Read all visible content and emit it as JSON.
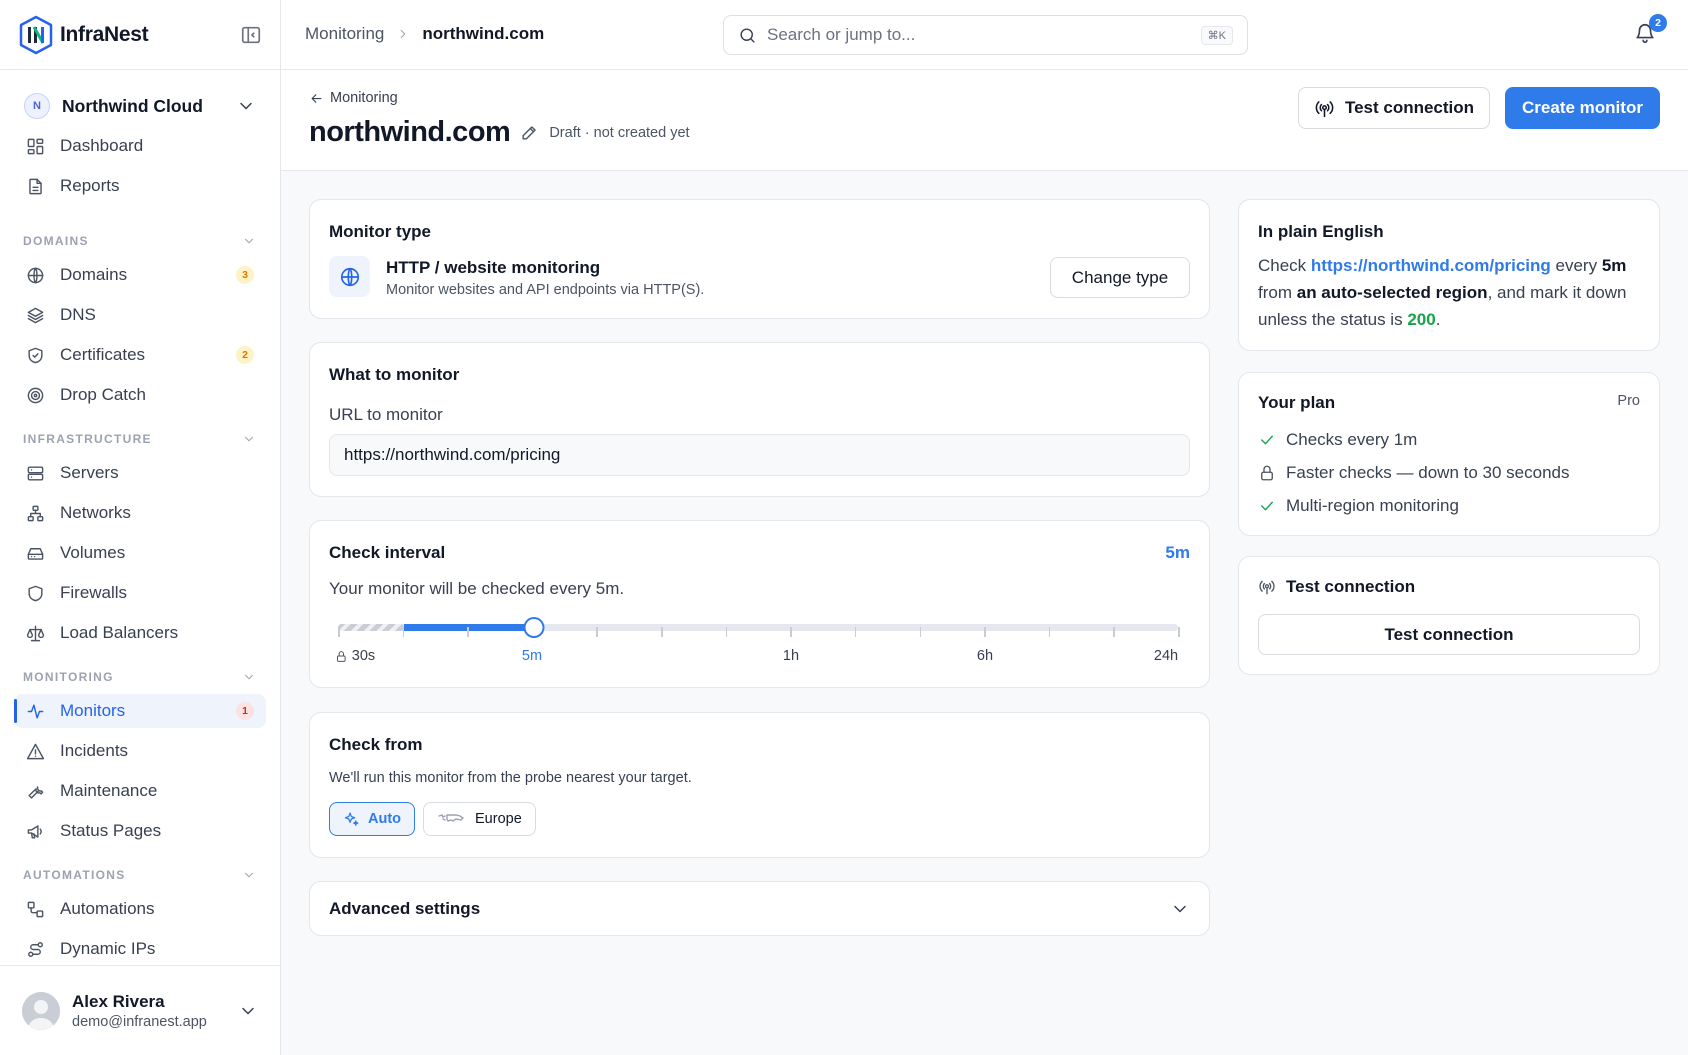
{
  "brand": {
    "name": "InfraNest"
  },
  "org": {
    "initial": "N",
    "name": "Northwind Cloud"
  },
  "nav": {
    "top": [
      {
        "label": "Dashboard",
        "icon": "dashboard-icon"
      },
      {
        "label": "Reports",
        "icon": "document-icon"
      }
    ],
    "sections": {
      "domains": "DOMAINS",
      "infrastructure": "INFRASTRUCTURE",
      "monitoring": "MONITORING",
      "automations": "AUTOMATIONS"
    },
    "domains": [
      {
        "label": "Domains",
        "icon": "globe-icon",
        "badge": "3"
      },
      {
        "label": "DNS",
        "icon": "layers-icon"
      },
      {
        "label": "Certificates",
        "icon": "shield-check-icon",
        "badge": "2"
      },
      {
        "label": "Drop Catch",
        "icon": "target-icon"
      }
    ],
    "infrastructure": [
      {
        "label": "Servers",
        "icon": "server-icon"
      },
      {
        "label": "Networks",
        "icon": "network-icon"
      },
      {
        "label": "Volumes",
        "icon": "hard-drive-icon"
      },
      {
        "label": "Firewalls",
        "icon": "shield-icon"
      },
      {
        "label": "Load Balancers",
        "icon": "scale-icon"
      }
    ],
    "monitoring": [
      {
        "label": "Monitors",
        "icon": "activity-icon",
        "badge": "1",
        "active": true
      },
      {
        "label": "Incidents",
        "icon": "alert-triangle-icon"
      },
      {
        "label": "Maintenance",
        "icon": "wrench-icon"
      },
      {
        "label": "Status Pages",
        "icon": "megaphone-icon"
      }
    ],
    "automations": [
      {
        "label": "Automations",
        "icon": "workflow-icon"
      },
      {
        "label": "Dynamic IPs",
        "icon": "route-icon"
      }
    ]
  },
  "user": {
    "name": "Alex Rivera",
    "email": "demo@infranest.app"
  },
  "topbar": {
    "breadcrumb": [
      "Monitoring",
      "northwind.com"
    ],
    "search_placeholder": "Search or jump to...",
    "search_shortcut": "⌘K",
    "notification_count": "2"
  },
  "page": {
    "back_label": "Monitoring",
    "title": "northwind.com",
    "status": "Draft · not created yet",
    "test_connection_label": "Test connection",
    "create_label": "Create monitor"
  },
  "monitor_type": {
    "title": "Monitor type",
    "name": "HTTP / website monitoring",
    "description": "Monitor websites and API endpoints via HTTP(S).",
    "change_label": "Change type"
  },
  "what": {
    "title": "What to monitor",
    "url_label": "URL to monitor",
    "url_value": "https://northwind.com/pricing"
  },
  "interval": {
    "title": "Check interval",
    "value": "5m",
    "description": "Your monitor will be checked every 5m.",
    "labels": [
      "30s",
      "5m",
      "1h",
      "6h",
      "24h"
    ],
    "selected_fraction": 0.233,
    "locked_fraction": 0.078
  },
  "check_from": {
    "title": "Check from",
    "description": "We'll run this monitor from the probe nearest your target.",
    "options": [
      {
        "label": "Auto",
        "icon": "sparkles-icon",
        "selected": true
      },
      {
        "label": "Europe",
        "icon": "europe-map-icon",
        "selected": false
      }
    ]
  },
  "advanced": {
    "title": "Advanced settings"
  },
  "plain_english": {
    "title": "In plain English",
    "p1": "Check ",
    "url": "https://northwind.com/pricing",
    "p2": " every ",
    "interval": "5m",
    "p3": " from ",
    "region": "an auto-selected region",
    "p4": ", and mark it down unless the status is ",
    "status": "200",
    "p5": "."
  },
  "plan": {
    "title": "Your plan",
    "tier": "Pro",
    "features": [
      {
        "text": "Checks every 1m",
        "icon": "check-icon"
      },
      {
        "text": "Faster checks — down to 30 seconds",
        "icon": "lock-icon"
      },
      {
        "text": "Multi-region monitoring",
        "icon": "check-icon"
      }
    ]
  },
  "test_panel": {
    "title": "Test connection",
    "button_label": "Test connection"
  },
  "colors": {
    "accent": "#2f7bea",
    "success": "#16a34a",
    "badge_amber": "#d97706",
    "badge_red": "#dc2626"
  }
}
